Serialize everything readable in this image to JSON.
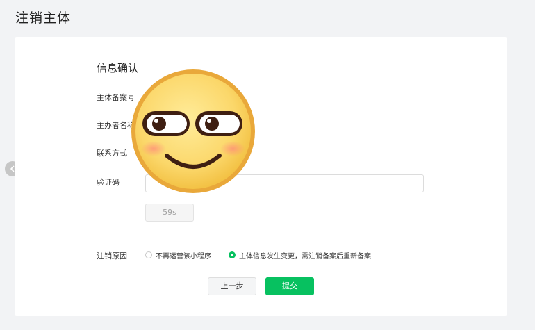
{
  "page": {
    "title": "注销主体"
  },
  "form": {
    "section_title": "信息确认",
    "fields": [
      {
        "label": "主体备案号"
      },
      {
        "label": "主办者名称"
      },
      {
        "label": "联系方式"
      },
      {
        "label": "验证码"
      }
    ],
    "verification": {
      "countdown": "59s"
    },
    "reason": {
      "label": "注销原因",
      "options": [
        {
          "label": "不再运营该小程序",
          "selected": false
        },
        {
          "label": "主体信息发生变更，需注销备案后重新备案",
          "selected": true
        }
      ]
    },
    "buttons": {
      "prev": "上一步",
      "submit": "提交"
    }
  },
  "overlay": {
    "icon": "smirk-emoji-sticker"
  },
  "nav": {
    "back_icon": "chevron-left-icon"
  },
  "colors": {
    "brand_green": "#07c160",
    "page_bg": "#f2f3f5",
    "card_bg": "#ffffff"
  }
}
